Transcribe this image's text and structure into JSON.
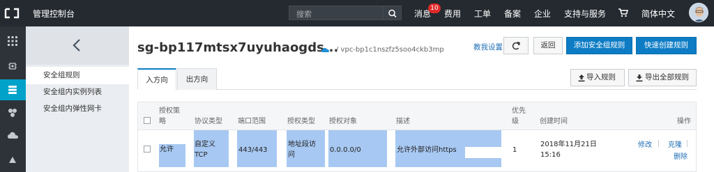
{
  "topbar": {
    "brand": "管理控制台",
    "search_placeholder": "搜索",
    "messages_label": "消息",
    "messages_badge": "10",
    "nav": [
      "费用",
      "工单",
      "备案",
      "企业",
      "支持与服务",
      "简体中文"
    ]
  },
  "subnav": {
    "items": [
      "安全组规则",
      "安全组内实例列表",
      "安全组内弹性网卡"
    ]
  },
  "header": {
    "title": "sg-bp117mtsx7uyuhaogds...",
    "vpc": "/ vpc-bp1c1nszfz5soo4ckb3mp",
    "tutorial_link": "教我设置",
    "back_button": "返回",
    "add_rule_button": "添加安全组规则",
    "quick_create_button": "快速创建规则"
  },
  "tabs": {
    "inbound": "入方向",
    "outbound": "出方向"
  },
  "toolbar": {
    "import_button": "导入规则",
    "export_button": "导出全部规则"
  },
  "table": {
    "headers": {
      "policy_l1": "授权策",
      "policy_l2": "略",
      "protocol": "协议类型",
      "port": "端口范围",
      "auth_type": "授权类型",
      "auth_object": "授权对象",
      "description": "描述",
      "priority_l1": "优先",
      "priority_l2": "级",
      "created": "创建时间",
      "actions": "操作"
    },
    "row": {
      "policy": "允许",
      "protocol_l1": "自定义",
      "protocol_l2": "TCP",
      "port": "443/443",
      "auth_type_l1": "地址段访",
      "auth_type_l2": "问",
      "auth_object": "0.0.0.0/0",
      "description": "允许外部访问https",
      "priority": "1",
      "created_l1": "2018年11月21日",
      "created_l2": "15:16",
      "edit": "修改",
      "clone": "克隆",
      "delete": "删除"
    }
  },
  "colors": {
    "topbar": "#252a30",
    "accent": "#00a2ca",
    "primary_button": "#0d7cc5",
    "selection_highlight": "#a7c8f2",
    "link": "#1f6fb5"
  },
  "icons": [
    "console-logo-icon",
    "search-icon",
    "cart-icon",
    "apps-grid-icon",
    "chip-icon",
    "database-icon",
    "network-icon",
    "cloud-icon",
    "back-chevron-icon",
    "refresh-icon",
    "upload-icon",
    "download-icon"
  ]
}
